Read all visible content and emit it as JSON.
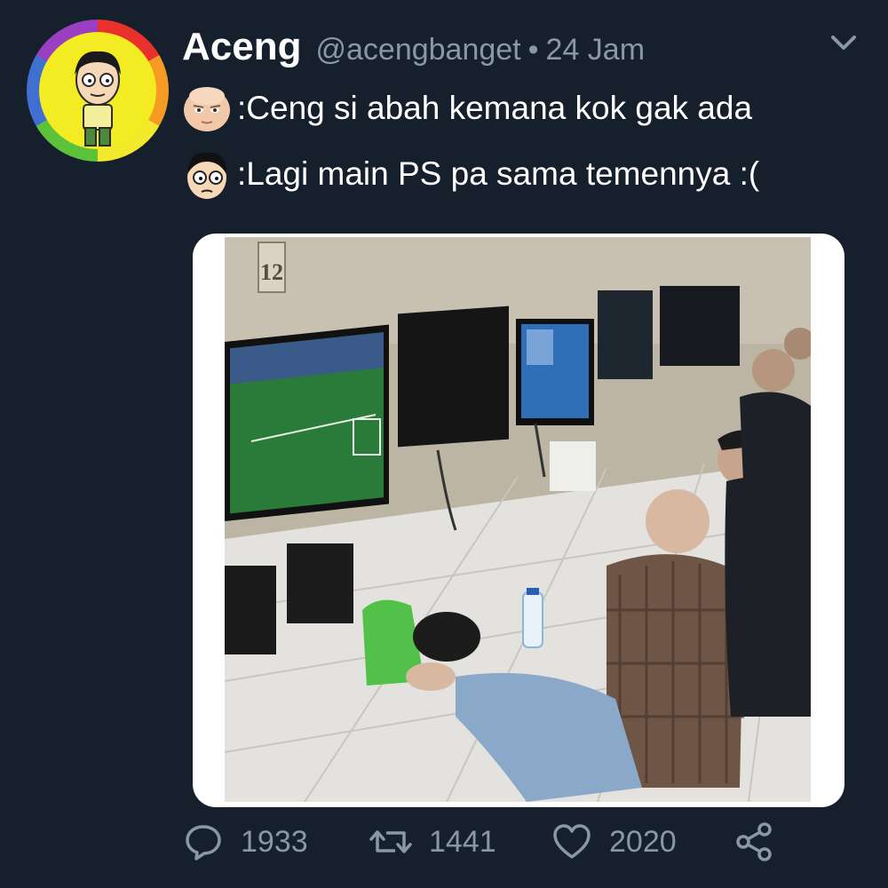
{
  "user": {
    "name": "Aceng",
    "handle": "@acengbanget",
    "separator": "•",
    "time": "24 Jam"
  },
  "dialog": [
    {
      "speaker": "baby-boss-emoji",
      "text": ":Ceng si abah kemana kok gak ada"
    },
    {
      "speaker": "aceng-emoji",
      "text": ":Lagi main PS pa sama temennya :("
    }
  ],
  "media": {
    "photo_number_sign": "12"
  },
  "actions": {
    "replies": "1933",
    "retweets": "1441",
    "likes": "2020"
  },
  "colors": {
    "background": "#161f2c",
    "muted_text": "#8c97a6",
    "text": "#ffffff"
  }
}
